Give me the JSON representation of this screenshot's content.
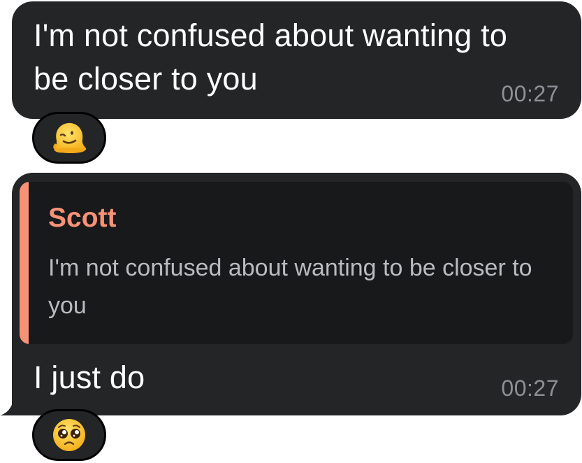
{
  "messages": [
    {
      "text": "I'm not confused about wanting to be closer to you",
      "time": "00:27",
      "reaction": "melting-face-emoji"
    },
    {
      "reply": {
        "author": "Scott",
        "text": "I'm not confused about wanting to be closer to you"
      },
      "text": "I just do",
      "time": "00:27",
      "reaction": "pleading-face-emoji"
    }
  ],
  "colors": {
    "bubble": "#232527",
    "reply_background": "#18191b",
    "reply_accent": "#f79277",
    "timestamp": "#8d9195",
    "reply_text": "#b9bcbf"
  }
}
